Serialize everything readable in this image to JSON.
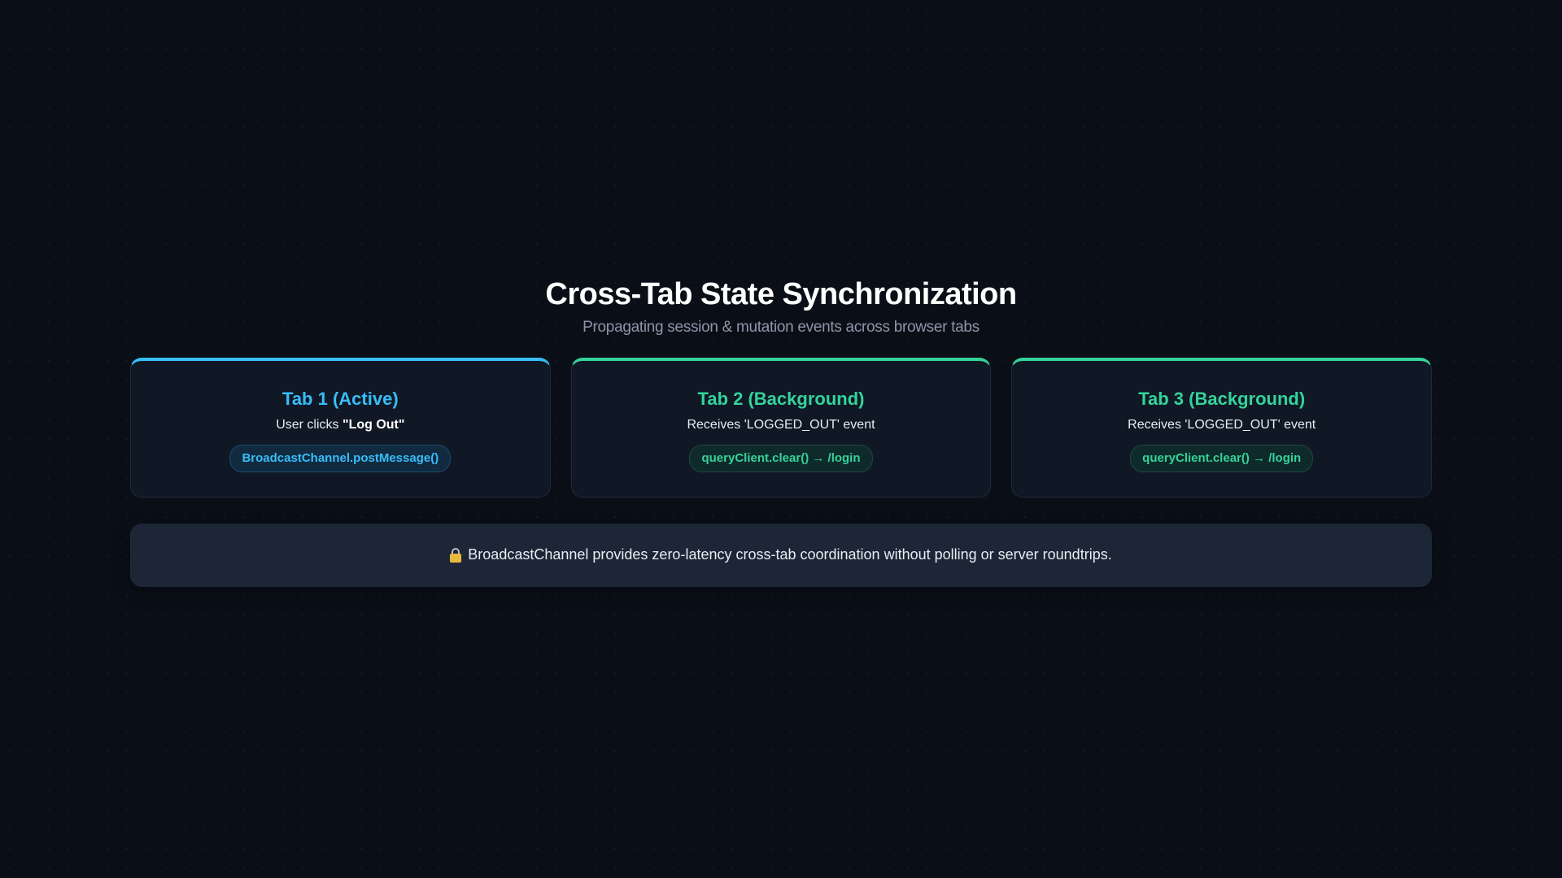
{
  "header": {
    "title": "Cross-Tab State Synchronization",
    "subtitle": "Propagating session & mutation events across browser tabs"
  },
  "colors": {
    "background": "#0a0f17",
    "card": "#101826",
    "accent_blue": "#38bdf8",
    "accent_green": "#34d399",
    "note_background": "#1c2636"
  },
  "tabs": [
    {
      "title": "Tab 1 (Active)",
      "desc_prefix": "User clicks ",
      "desc_bold": "\"Log Out\"",
      "pill": "BroadcastChannel.postMessage()",
      "accent": "blue"
    },
    {
      "title": "Tab 2 (Background)",
      "desc": "Receives 'LOGGED_OUT' event",
      "pill": "queryClient.clear() → /login",
      "accent": "green"
    },
    {
      "title": "Tab 3 (Background)",
      "desc": "Receives 'LOGGED_OUT' event",
      "pill": "queryClient.clear() → /login",
      "accent": "green"
    }
  ],
  "note": {
    "icon": "lock-icon",
    "text": "BroadcastChannel provides zero-latency cross-tab coordination without polling or server roundtrips."
  }
}
